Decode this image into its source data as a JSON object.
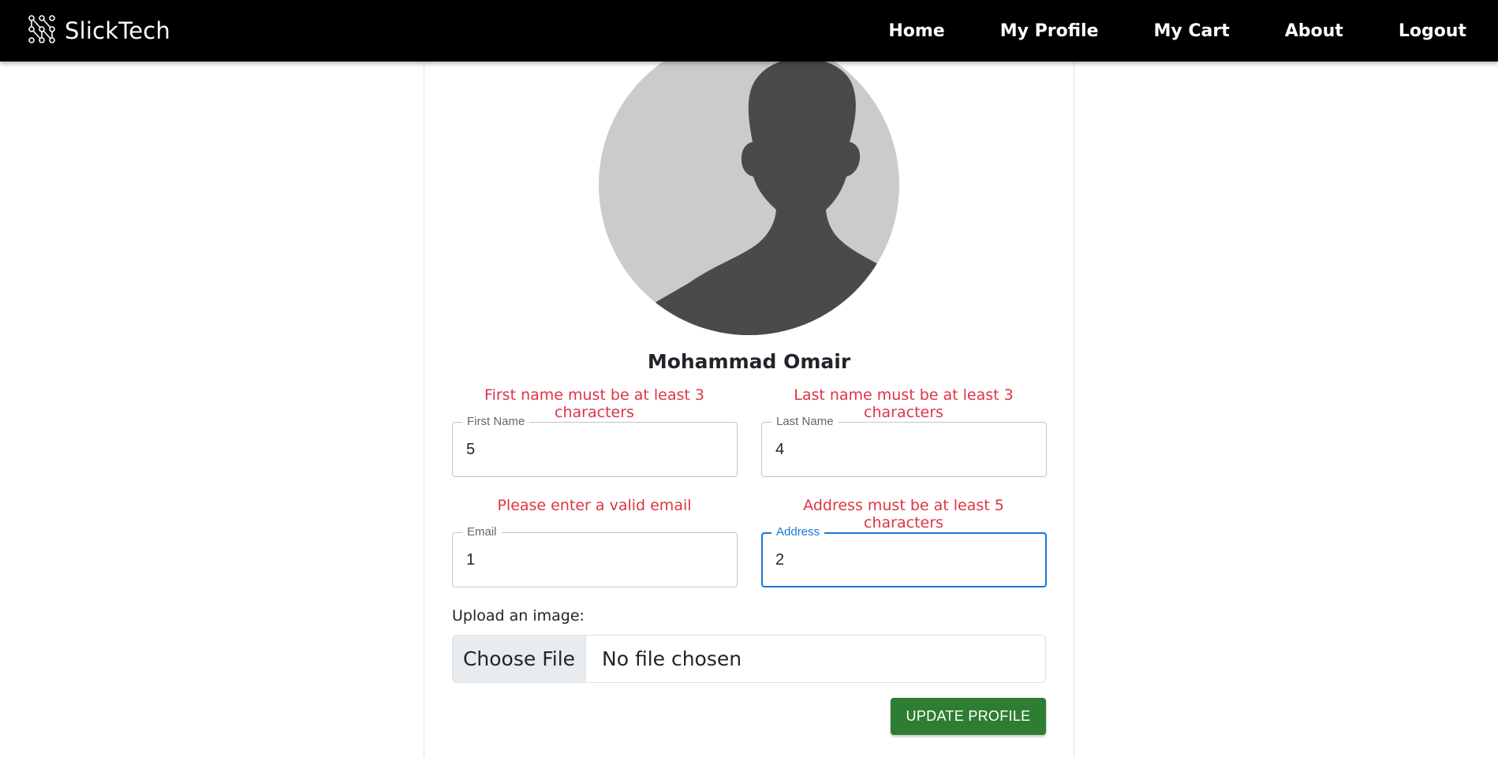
{
  "brand": {
    "name": "SlickTech",
    "icon": "circuit-logo-icon"
  },
  "nav": {
    "links": [
      "Home",
      "My Profile",
      "My Cart",
      "About",
      "Logout"
    ]
  },
  "profile": {
    "avatar_icon": "default-user-avatar-icon",
    "full_name": "Mohammad Omair"
  },
  "form": {
    "first_name": {
      "label": "First Name",
      "value": "5",
      "error": "First name must be at least 3 characters"
    },
    "last_name": {
      "label": "Last Name",
      "value": "4",
      "error": "Last name must be at least 3 characters"
    },
    "email": {
      "label": "Email",
      "value": "1",
      "error": "Please enter a valid email"
    },
    "address": {
      "label": "Address",
      "value": "2",
      "error": "Address must be at least 5 characters"
    },
    "upload": {
      "label": "Upload an image:",
      "button": "Choose File",
      "status": "No file chosen"
    },
    "submit_label": "UPDATE PROFILE"
  },
  "colors": {
    "navbar_bg": "#000000",
    "error": "#dc3545",
    "focus": "#1976d2",
    "submit_bg": "#2e7d32",
    "avatar_bg": "#cbcbcb",
    "avatar_silhouette": "#4a4a4a"
  }
}
